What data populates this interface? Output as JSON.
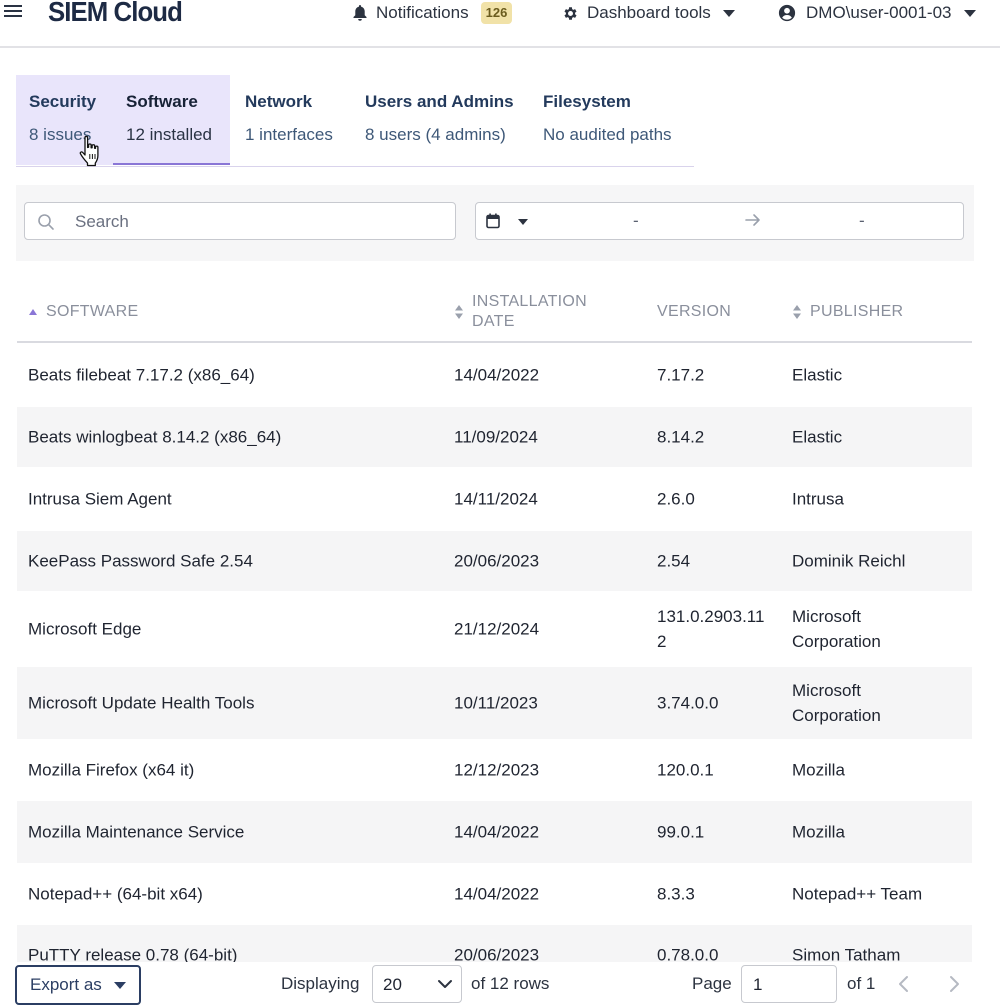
{
  "header": {
    "brand": "SIEM Cloud",
    "notifications_label": "Notifications",
    "notifications_count": "126",
    "dashboard_tools_label": "Dashboard tools",
    "user_label": "DMO\\user-0001-03"
  },
  "tabs": [
    {
      "title": "Security",
      "subtitle": "8 issues"
    },
    {
      "title": "Software",
      "subtitle": "12 installed"
    },
    {
      "title": "Network",
      "subtitle": "1 interfaces"
    },
    {
      "title": "Users and Admins",
      "subtitle": "8 users (4 admins)"
    },
    {
      "title": "Filesystem",
      "subtitle": "No audited paths"
    }
  ],
  "filters": {
    "search_placeholder": "Search",
    "date_from": "-",
    "date_to": "-"
  },
  "table": {
    "columns": [
      "SOFTWARE",
      "INSTALLATION DATE",
      "VERSION",
      "PUBLISHER"
    ],
    "rows": [
      [
        "Beats filebeat 7.17.2 (x86_64)",
        "14/04/2022",
        "7.17.2",
        "Elastic"
      ],
      [
        "Beats winlogbeat 8.14.2 (x86_64)",
        "11/09/2024",
        "8.14.2",
        "Elastic"
      ],
      [
        "Intrusa Siem Agent",
        "14/11/2024",
        "2.6.0",
        "Intrusa"
      ],
      [
        "KeePass Password Safe 2.54",
        "20/06/2023",
        "2.54",
        "Dominik Reichl"
      ],
      [
        "Microsoft Edge",
        "21/12/2024",
        "131.0.2903.112",
        "Microsoft Corporation"
      ],
      [
        "Microsoft Update Health Tools",
        "10/11/2023",
        "3.74.0.0",
        "Microsoft Corporation"
      ],
      [
        "Mozilla Firefox (x64 it)",
        "12/12/2023",
        "120.0.1",
        "Mozilla"
      ],
      [
        "Mozilla Maintenance Service",
        "14/04/2022",
        "99.0.1",
        "Mozilla"
      ],
      [
        "Notepad++ (64-bit x64)",
        "14/04/2022",
        "8.3.3",
        "Notepad++ Team"
      ],
      [
        "PuTTY release 0.78 (64-bit)",
        "20/06/2023",
        "0.78.0.0",
        "Simon Tatham"
      ]
    ]
  },
  "footer": {
    "export_label": "Export as",
    "displaying_label": "Displaying",
    "page_size": "20",
    "rows_label": "of 12 rows",
    "page_label": "Page",
    "page_value": "1",
    "of_pages_label": "of 1"
  },
  "colors": {
    "accent": "#8a76d6",
    "tab_highlight": "#e9e5fb",
    "badge": "#f1e2a8",
    "brand": "#1d2a44"
  }
}
